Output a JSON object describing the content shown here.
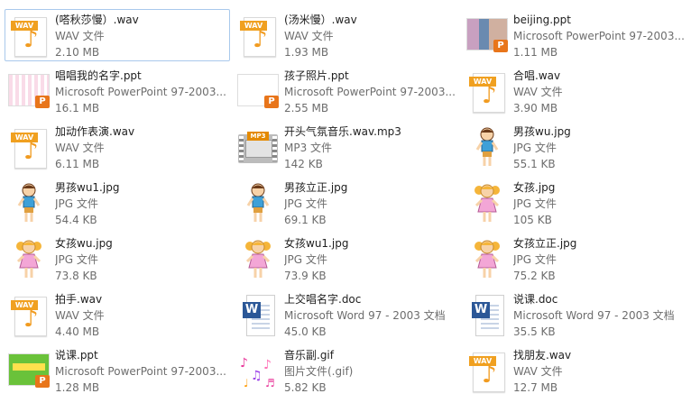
{
  "files": [
    {
      "name": "(嗒秋莎慢）.wav",
      "type": "WAV 文件",
      "size": "2.10 MB",
      "icon": "wav-icon",
      "selected": true
    },
    {
      "name": "(汤米慢）.wav",
      "type": "WAV 文件",
      "size": "1.93 MB",
      "icon": "wav-icon"
    },
    {
      "name": "beijing.ppt",
      "type": "Microsoft PowerPoint 97-2003...",
      "size": "1.11 MB",
      "icon": "ppt-photo-thumb"
    },
    {
      "name": "唱唱我的名字.ppt",
      "type": "Microsoft PowerPoint 97-2003...",
      "size": "16.1 MB",
      "icon": "ppt-pink-thumb"
    },
    {
      "name": "孩子照片.ppt",
      "type": "Microsoft PowerPoint 97-2003...",
      "size": "2.55 MB",
      "icon": "ppt-blank-thumb"
    },
    {
      "name": "合唱.wav",
      "type": "WAV 文件",
      "size": "3.90 MB",
      "icon": "wav-icon"
    },
    {
      "name": "加动作表演.wav",
      "type": "WAV 文件",
      "size": "6.11 MB",
      "icon": "wav-icon"
    },
    {
      "name": "开头气氛音乐.wav.mp3",
      "type": "MP3 文件",
      "size": "142 KB",
      "icon": "mp3-icon"
    },
    {
      "name": "男孩wu.jpg",
      "type": "JPG 文件",
      "size": "55.1 KB",
      "icon": "boy-thumb"
    },
    {
      "name": "男孩wu1.jpg",
      "type": "JPG 文件",
      "size": "54.4 KB",
      "icon": "boy-thumb"
    },
    {
      "name": "男孩立正.jpg",
      "type": "JPG 文件",
      "size": "69.1 KB",
      "icon": "boy-thumb"
    },
    {
      "name": "女孩.jpg",
      "type": "JPG 文件",
      "size": "105 KB",
      "icon": "girl-thumb"
    },
    {
      "name": "女孩wu.jpg",
      "type": "JPG 文件",
      "size": "73.8 KB",
      "icon": "girl-thumb"
    },
    {
      "name": "女孩wu1.jpg",
      "type": "JPG 文件",
      "size": "73.9 KB",
      "icon": "girl-thumb"
    },
    {
      "name": "女孩立正.jpg",
      "type": "JPG 文件",
      "size": "75.2 KB",
      "icon": "girl-thumb"
    },
    {
      "name": "拍手.wav",
      "type": "WAV 文件",
      "size": "4.40 MB",
      "icon": "wav-icon"
    },
    {
      "name": "上交唱名字.doc",
      "type": "Microsoft Word 97 - 2003 文档",
      "size": "45.0 KB",
      "icon": "word-icon"
    },
    {
      "name": "说课.doc",
      "type": "Microsoft Word 97 - 2003 文档",
      "size": "35.5 KB",
      "icon": "word-icon"
    },
    {
      "name": "说课.ppt",
      "type": "Microsoft PowerPoint 97-2003...",
      "size": "1.28 MB",
      "icon": "ppt-green-thumb"
    },
    {
      "name": "音乐副.gif",
      "type": "图片文件(.gif)",
      "size": "5.82 KB",
      "icon": "music-notes-thumb"
    },
    {
      "name": "找朋友.wav",
      "type": "WAV 文件",
      "size": "12.7 MB",
      "icon": "wav-icon"
    }
  ],
  "icon_labels": {
    "wav": "WAV",
    "mp3": "MP3",
    "word": "W",
    "ppt": "P"
  },
  "colors": {
    "selection_border": "#a9c9ec",
    "wav_orange": "#f0a020",
    "word_blue": "#2b5797",
    "ppt_orange": "#e8751a"
  }
}
